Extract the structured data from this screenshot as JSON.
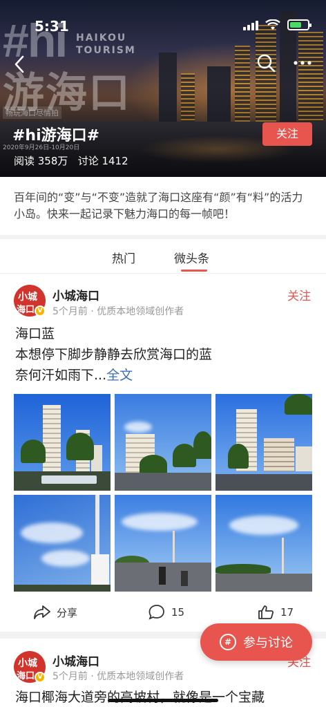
{
  "status_bar": {
    "time": "5:31"
  },
  "hero": {
    "brand_hash": "#hi",
    "brand_en_line1": "HAIKOU",
    "brand_en_line2": "TOURISM",
    "brand_cn": "游海口",
    "brand_sub": "畅玩海口尽情拍",
    "title": "#hi游海口#",
    "dates": "2020年9月26日-10月20日",
    "stats": "阅读 358万   讨论 1412",
    "follow_label": "关注"
  },
  "intro": "百年间的“变”与“不变”造就了海口这座有“颜”有“料”的活力小岛。快来一起记录下魅力海口的每一帧吧！",
  "tabs": [
    {
      "label": "热门"
    },
    {
      "label": "微头条"
    }
  ],
  "posts": [
    {
      "avatar_text_1": "小城",
      "avatar_text_2": "海口",
      "author": "小城海口",
      "meta": "5个月前 · 优质本地领域创作者",
      "follow": "关注",
      "line1": "海口蓝",
      "line2": "本想停下脚步静静去欣赏海口的蓝",
      "line3": "奈何汗如雨下...",
      "fulltext": "全文",
      "actions": {
        "share": "分享",
        "comments": "15",
        "likes": "17"
      }
    },
    {
      "avatar_text_1": "小城",
      "avatar_text_2": "海口",
      "author": "小城海口",
      "meta": "5个月前 · 优质本地领域创作者",
      "follow": "关注",
      "line1": "海口椰海大道旁的高坡村，就像是一个宝藏"
    }
  ],
  "fab": {
    "label": "参与讨论"
  },
  "colors": {
    "accent": "#e8554e",
    "link": "#3b6fb6"
  }
}
